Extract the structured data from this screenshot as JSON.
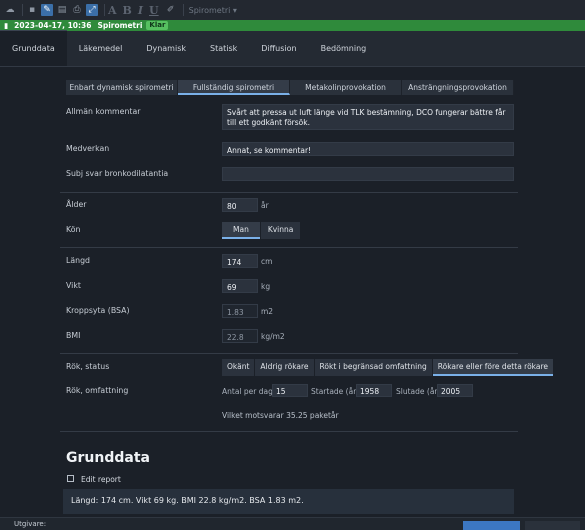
{
  "toolbar": {
    "letters": [
      "A",
      "B",
      "I",
      "U"
    ],
    "template_select": "Spirometri",
    "dropdown_arrow": "▾"
  },
  "status": {
    "datetime": "2023-04-17, 10:36",
    "exam": "Spirometri",
    "badge": "Klar",
    "badge_color": "#56c060",
    "bar_color": "#2f8a3b"
  },
  "tabs": [
    "Grunddata",
    "Läkemedel",
    "Dynamisk",
    "Statisk",
    "Diffusion",
    "Bedömning"
  ],
  "subtabs": [
    "Enbart dynamisk spirometri",
    "Fullständig spirometri",
    "Metakolinprovokation",
    "Ansträngningsprovokation"
  ],
  "form": {
    "comment_label": "Allmän kommentar",
    "comment_value": "Svårt att pressa ut luft länge vid TLK bestämning, DCO fungerar bättre får till ett godkänt försök.",
    "medverkan_label": "Medverkan",
    "medverkan_value": "Annat, se kommentar!",
    "subj_label": "Subj svar bronkodilatantia",
    "subj_value": "",
    "alder_label": "Ålder",
    "alder_value": "80",
    "alder_unit": "år",
    "kon_label": "Kön",
    "kon_options": [
      "Man",
      "Kvinna"
    ],
    "langd_label": "Längd",
    "langd_value": "174",
    "langd_unit": "cm",
    "vikt_label": "Vikt",
    "vikt_value": "69",
    "vikt_unit": "kg",
    "bsa_label": "Kroppsyta (BSA)",
    "bsa_value": "1.83",
    "bsa_unit": "m2",
    "bmi_label": "BMI",
    "bmi_value": "22.8",
    "bmi_unit": "kg/m2",
    "rok_status_label": "Rök, status",
    "rok_status_options": [
      "Okänt",
      "Aldrig rökare",
      "Rökt i begränsad omfattning",
      "Rökare eller före detta rökare"
    ],
    "rok_omf_label": "Rök, omfattning",
    "antal_label": "Antal per dag:",
    "antal_value": "15",
    "startade_label": "Startade (år):",
    "startade_value": "1958",
    "slutade_label": "Slutade (år):",
    "slutade_value": "2005",
    "paketar_text": "Vilket motsvarar 35.25 paketår"
  },
  "report": {
    "heading": "Grunddata",
    "edit_label": "Edit report",
    "summary": "Längd: 174 cm. Vikt 69 kg. BMI 22.8 kg/m2. BSA 1.83 m2."
  },
  "footer": {
    "label": "Utgivare:"
  }
}
